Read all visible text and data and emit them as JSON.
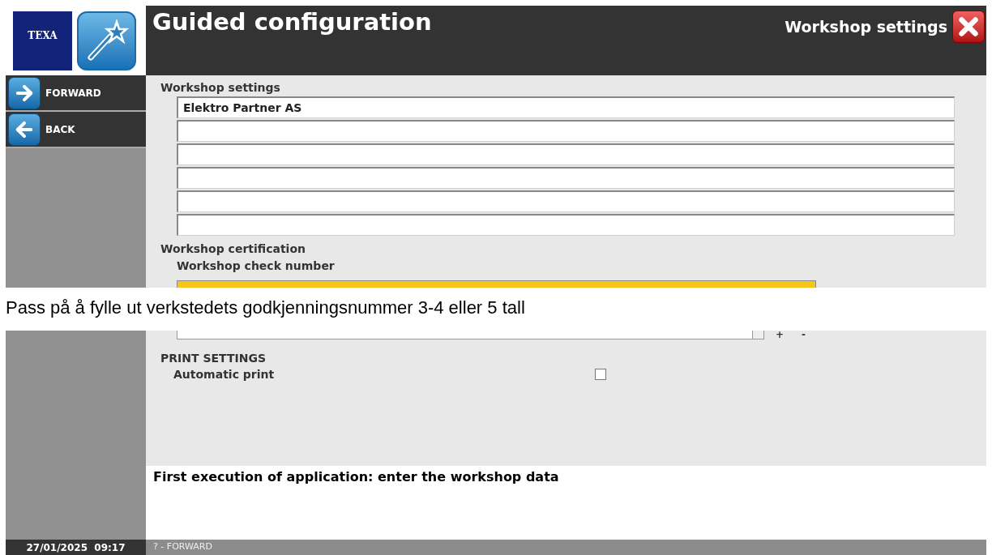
{
  "logo": {
    "text": "TEXA"
  },
  "header": {
    "title": "Guided configuration",
    "section": "Workshop settings"
  },
  "sidebar": {
    "buttons": [
      {
        "label": "FORWARD",
        "kind": "forward"
      },
      {
        "label": "BACK",
        "kind": "back"
      }
    ]
  },
  "workshop_settings": {
    "title": "Workshop settings",
    "fields": [
      {
        "kind": "text",
        "value": "Elektro Partner AS"
      },
      {
        "kind": "text"
      },
      {
        "kind": "text"
      },
      {
        "kind": "text"
      },
      {
        "kind": "text"
      },
      {
        "kind": "text"
      }
    ]
  },
  "certification": {
    "title": "Workshop certification",
    "check_number": {
      "label": "Workshop check number"
    },
    "operator": {
      "add": "+",
      "remove": "-"
    }
  },
  "print_settings": {
    "title": "PRINT SETTINGS",
    "automatic_print": {
      "label": "Automatic print",
      "checked": false
    }
  },
  "message": "First execution of application: enter the workshop data",
  "status_bar": {
    "datetime": "27/01/2025  09:17",
    "hint": "? - FORWARD"
  },
  "note": {
    "text": "Pass på å fylle ut verkstedets godkjenningsnummer 3-4 eller 5 tall"
  }
}
